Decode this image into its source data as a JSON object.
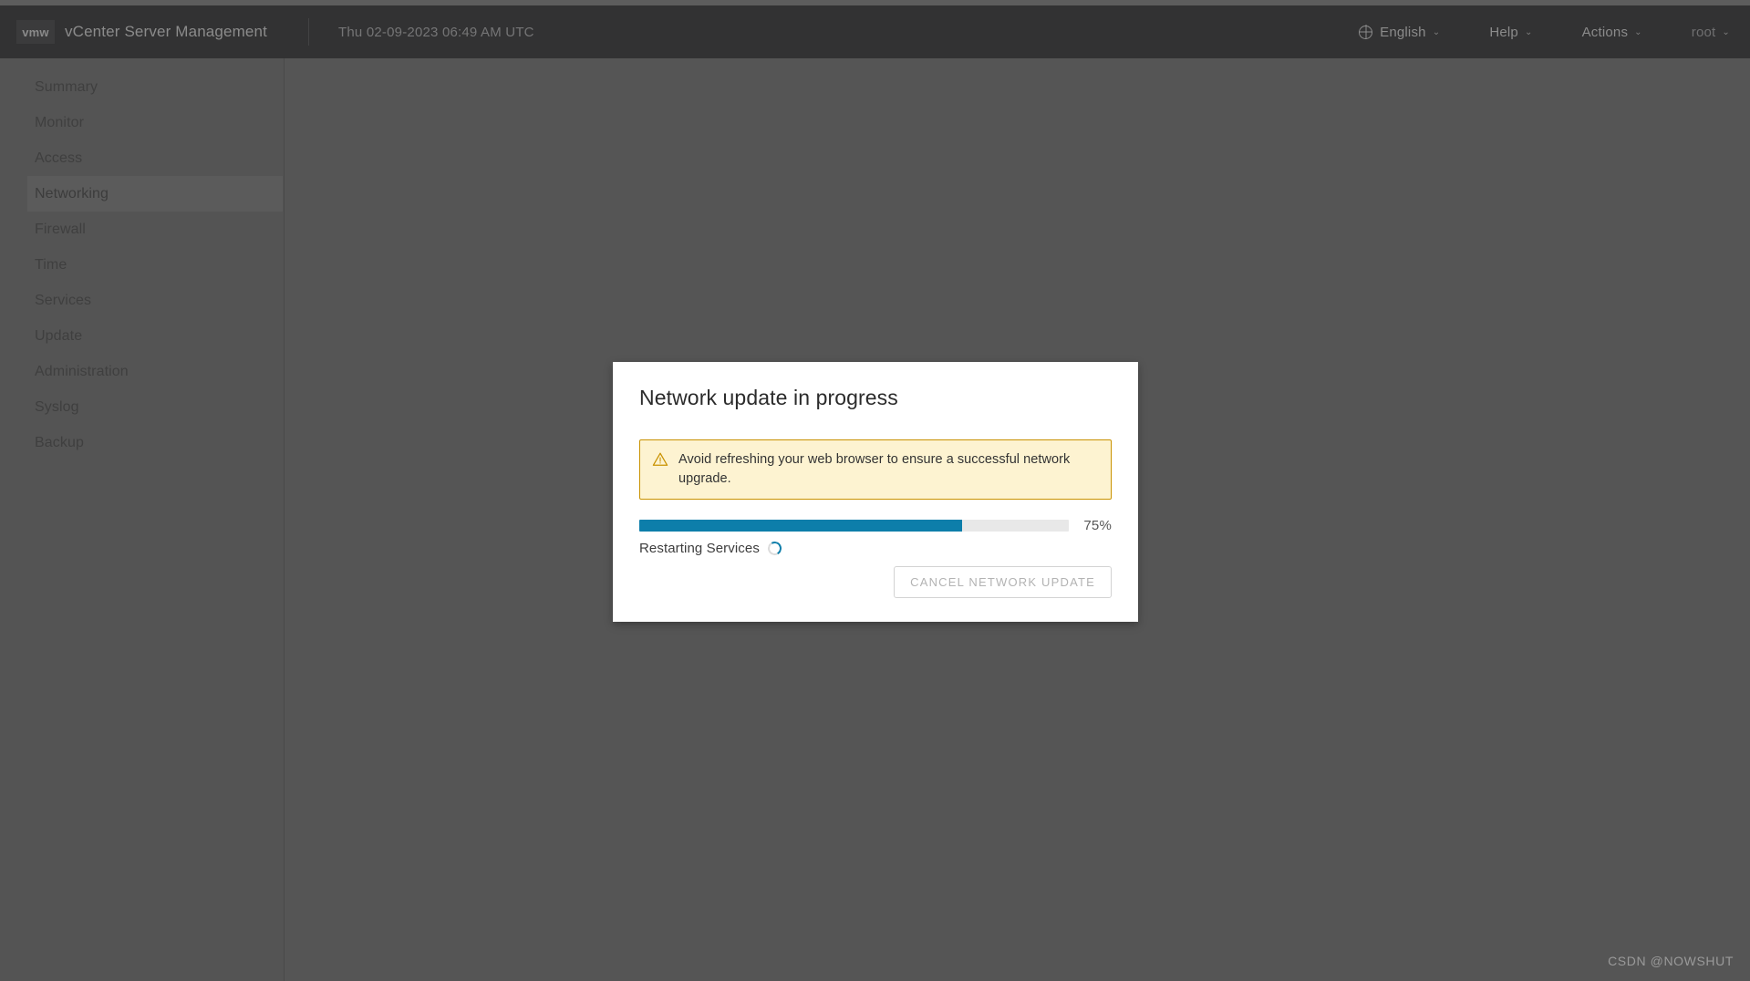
{
  "header": {
    "logo": "vmw",
    "title": "vCenter Server Management",
    "datetime": "Thu 02-09-2023 06:49 AM UTC",
    "language": "English",
    "language_icon": "globe-icon",
    "help": "Help",
    "actions": "Actions",
    "user": "root",
    "caret": "⌄"
  },
  "sidebar": {
    "items": [
      {
        "label": "Summary",
        "active": false
      },
      {
        "label": "Monitor",
        "active": false
      },
      {
        "label": "Access",
        "active": false
      },
      {
        "label": "Networking",
        "active": true
      },
      {
        "label": "Firewall",
        "active": false
      },
      {
        "label": "Time",
        "active": false
      },
      {
        "label": "Services",
        "active": false
      },
      {
        "label": "Update",
        "active": false
      },
      {
        "label": "Administration",
        "active": false
      },
      {
        "label": "Syslog",
        "active": false
      },
      {
        "label": "Backup",
        "active": false
      }
    ]
  },
  "modal": {
    "title": "Network update in progress",
    "alert": {
      "icon": "warning-triangle-icon",
      "message": "Avoid refreshing your web browser to ensure a successful network upgrade.",
      "bg_color": "#fdf3d1",
      "border_color": "#c99200"
    },
    "progress": {
      "percent": 75,
      "percent_label": "75%",
      "fill_color": "#0d7eaa",
      "track_color": "#e8e8e8"
    },
    "status": {
      "text": "Restarting Services",
      "spinner_icon": "loading-spinner-icon"
    },
    "cancel_button": {
      "label": "CANCEL NETWORK UPDATE",
      "disabled": true
    }
  },
  "watermark": "CSDN @NOWSHUT"
}
